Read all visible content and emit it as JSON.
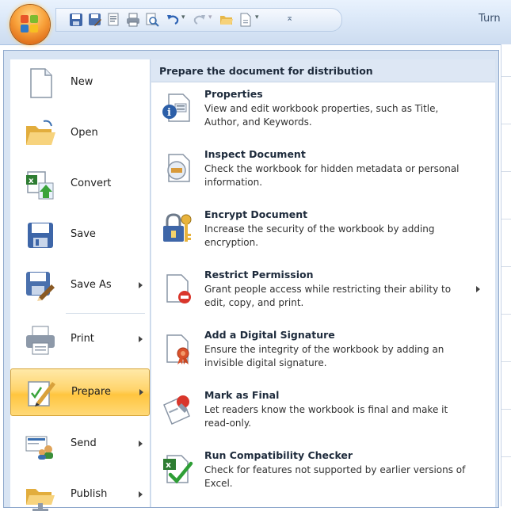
{
  "window": {
    "title": "Turn"
  },
  "quick_access_toolbar": {
    "icons": [
      "save-icon",
      "save-as-icon",
      "print-preview-icon",
      "print-icon",
      "preview-icon",
      "undo-icon",
      "redo-icon",
      "open-folder-icon",
      "new-document-icon",
      "customize-icon"
    ]
  },
  "menu": {
    "commands": [
      {
        "label": "New",
        "icon": "new-document-icon",
        "has_submenu": false
      },
      {
        "label": "Open",
        "icon": "open-folder-icon",
        "has_submenu": false
      },
      {
        "label": "Convert",
        "icon": "convert-icon",
        "has_submenu": false
      },
      {
        "label": "Save",
        "icon": "save-icon",
        "has_submenu": false
      },
      {
        "label": "Save As",
        "icon": "save-as-icon",
        "has_submenu": true
      },
      {
        "label": "Print",
        "icon": "printer-icon",
        "has_submenu": true
      },
      {
        "label": "Prepare",
        "icon": "prepare-icon",
        "has_submenu": true,
        "selected": true
      },
      {
        "label": "Send",
        "icon": "send-icon",
        "has_submenu": true
      },
      {
        "label": "Publish",
        "icon": "publish-icon",
        "has_submenu": true
      }
    ],
    "submenu": {
      "header": "Prepare the document for distribution",
      "items": [
        {
          "title": "Properties",
          "description": "View and edit workbook properties, such as Title, Author, and Keywords.",
          "icon": "properties-icon",
          "has_submenu": false
        },
        {
          "title": "Inspect Document",
          "description": "Check the workbook for hidden metadata or personal information.",
          "icon": "inspect-document-icon",
          "has_submenu": false
        },
        {
          "title": "Encrypt Document",
          "description": "Increase the security of the workbook by adding encryption.",
          "icon": "encrypt-lock-icon",
          "has_submenu": false
        },
        {
          "title": "Restrict Permission",
          "description": "Grant people access while restricting their ability to edit, copy, and print.",
          "icon": "restrict-permission-icon",
          "has_submenu": true
        },
        {
          "title": "Add a Digital Signature",
          "description": "Ensure the integrity of the workbook by adding an invisible digital signature.",
          "icon": "digital-signature-icon",
          "has_submenu": false
        },
        {
          "title": "Mark as Final",
          "description": "Let readers know the workbook is final and make it read-only.",
          "icon": "mark-as-final-icon",
          "has_submenu": false
        },
        {
          "title": "Run Compatibility Checker",
          "description": "Check for features not supported by earlier versions of Excel.",
          "icon": "compatibility-checker-icon",
          "has_submenu": false
        }
      ]
    }
  },
  "colors": {
    "selected_highlight": "#ffd46b",
    "menu_background": "#d8e4f3",
    "office_button": "#f8a13a"
  }
}
